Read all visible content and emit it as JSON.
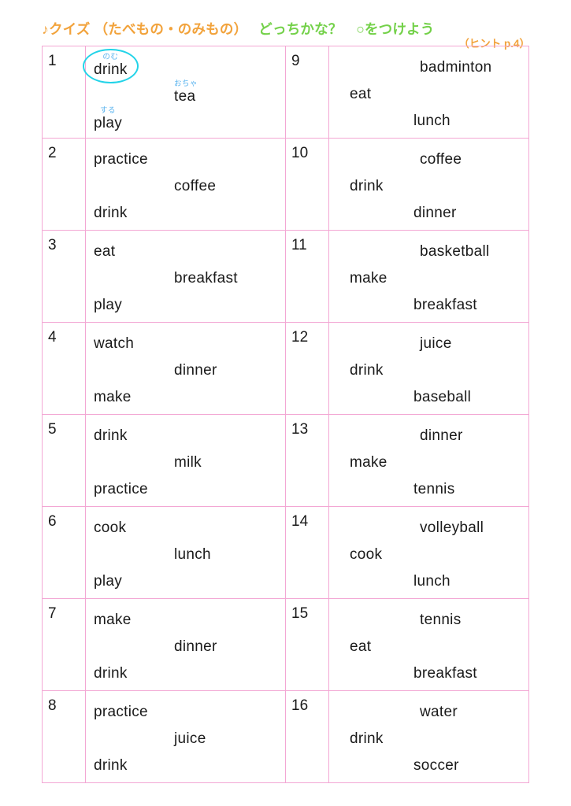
{
  "header": {
    "title_main": "♪クイズ （たべもの・のみもの）",
    "title_sub": "どっちかな？　○をつけよう",
    "hint": "（ヒント p.4）",
    "colors": {
      "title_main": "#f2a33c",
      "title_sub": "#74d14a",
      "hint": "#f2a33c",
      "table_border": "#f3a7d4",
      "furigana": "#5ab4ef",
      "circle": "#22d3e8"
    }
  },
  "table": {
    "rows": [
      {
        "left": {
          "number": "1",
          "words": [
            {
              "text": "drink",
              "furigana": "のむ",
              "circled": true
            },
            {
              "text": "tea",
              "furigana": "おちゃ",
              "circled": false
            },
            {
              "text": "play",
              "furigana": "する",
              "circled": false
            }
          ]
        },
        "right": {
          "number": "9",
          "words": [
            {
              "text": "badminton",
              "furigana": "",
              "circled": false
            },
            {
              "text": "eat",
              "furigana": "",
              "circled": false
            },
            {
              "text": "lunch",
              "furigana": "",
              "circled": false
            }
          ]
        }
      },
      {
        "left": {
          "number": "2",
          "words": [
            {
              "text": "practice",
              "furigana": "",
              "circled": false
            },
            {
              "text": "coffee",
              "furigana": "",
              "circled": false
            },
            {
              "text": "drink",
              "furigana": "",
              "circled": false
            }
          ]
        },
        "right": {
          "number": "10",
          "words": [
            {
              "text": "coffee",
              "furigana": "",
              "circled": false
            },
            {
              "text": "drink",
              "furigana": "",
              "circled": false
            },
            {
              "text": "dinner",
              "furigana": "",
              "circled": false
            }
          ]
        }
      },
      {
        "left": {
          "number": "3",
          "words": [
            {
              "text": "eat",
              "furigana": "",
              "circled": false
            },
            {
              "text": "breakfast",
              "furigana": "",
              "circled": false
            },
            {
              "text": "play",
              "furigana": "",
              "circled": false
            }
          ]
        },
        "right": {
          "number": "11",
          "words": [
            {
              "text": "basketball",
              "furigana": "",
              "circled": false
            },
            {
              "text": "make",
              "furigana": "",
              "circled": false
            },
            {
              "text": "breakfast",
              "furigana": "",
              "circled": false
            }
          ]
        }
      },
      {
        "left": {
          "number": "4",
          "words": [
            {
              "text": "watch",
              "furigana": "",
              "circled": false
            },
            {
              "text": "dinner",
              "furigana": "",
              "circled": false
            },
            {
              "text": "make",
              "furigana": "",
              "circled": false
            }
          ]
        },
        "right": {
          "number": "12",
          "words": [
            {
              "text": "juice",
              "furigana": "",
              "circled": false
            },
            {
              "text": "drink",
              "furigana": "",
              "circled": false
            },
            {
              "text": "baseball",
              "furigana": "",
              "circled": false
            }
          ]
        }
      },
      {
        "left": {
          "number": "5",
          "words": [
            {
              "text": "drink",
              "furigana": "",
              "circled": false
            },
            {
              "text": "milk",
              "furigana": "",
              "circled": false
            },
            {
              "text": "practice",
              "furigana": "",
              "circled": false
            }
          ]
        },
        "right": {
          "number": "13",
          "words": [
            {
              "text": "dinner",
              "furigana": "",
              "circled": false
            },
            {
              "text": "make",
              "furigana": "",
              "circled": false
            },
            {
              "text": "tennis",
              "furigana": "",
              "circled": false
            }
          ]
        }
      },
      {
        "left": {
          "number": "6",
          "words": [
            {
              "text": "cook",
              "furigana": "",
              "circled": false
            },
            {
              "text": "lunch",
              "furigana": "",
              "circled": false
            },
            {
              "text": "play",
              "furigana": "",
              "circled": false
            }
          ]
        },
        "right": {
          "number": "14",
          "words": [
            {
              "text": "volleyball",
              "furigana": "",
              "circled": false
            },
            {
              "text": "cook",
              "furigana": "",
              "circled": false
            },
            {
              "text": "lunch",
              "furigana": "",
              "circled": false
            }
          ]
        }
      },
      {
        "left": {
          "number": "7",
          "words": [
            {
              "text": "make",
              "furigana": "",
              "circled": false
            },
            {
              "text": "dinner",
              "furigana": "",
              "circled": false
            },
            {
              "text": "drink",
              "furigana": "",
              "circled": false
            }
          ]
        },
        "right": {
          "number": "15",
          "words": [
            {
              "text": "tennis",
              "furigana": "",
              "circled": false
            },
            {
              "text": "eat",
              "furigana": "",
              "circled": false
            },
            {
              "text": "breakfast",
              "furigana": "",
              "circled": false
            }
          ]
        }
      },
      {
        "left": {
          "number": "8",
          "words": [
            {
              "text": "practice",
              "furigana": "",
              "circled": false
            },
            {
              "text": "juice",
              "furigana": "",
              "circled": false
            },
            {
              "text": "drink",
              "furigana": "",
              "circled": false
            }
          ]
        },
        "right": {
          "number": "16",
          "words": [
            {
              "text": "water",
              "furigana": "",
              "circled": false
            },
            {
              "text": "drink",
              "furigana": "",
              "circled": false
            },
            {
              "text": "soccer",
              "furigana": "",
              "circled": false
            }
          ]
        }
      }
    ]
  }
}
